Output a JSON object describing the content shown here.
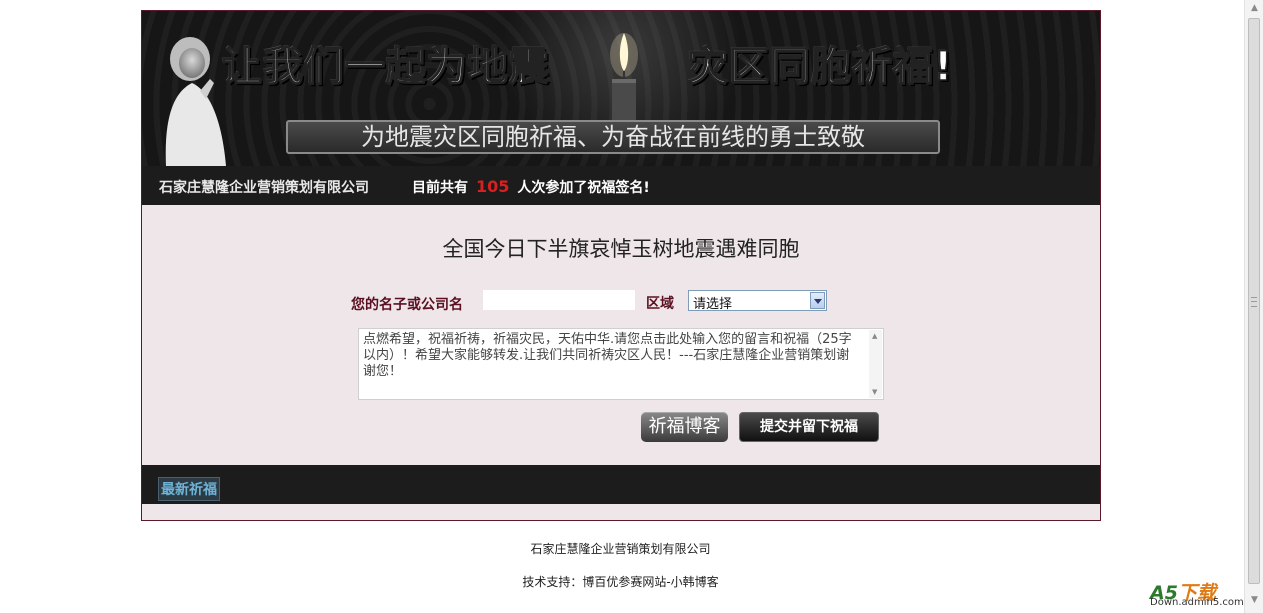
{
  "banner": {
    "headline_left": "让我们一起为地震",
    "headline_right": "灾区同胞祈福!",
    "subtitle": "为地震灾区同胞祈福、为奋战在前线的勇士致敬"
  },
  "info_bar": {
    "company": "石家庄慧隆企业营销策划有限公司",
    "counter_prefix": "目前共有",
    "counter_value": "105",
    "counter_suffix": "人次参加了祝福签名!"
  },
  "form": {
    "title": "全国今日下半旗哀悼玉树地震遇难同胞",
    "name_label": "您的名子或公司名",
    "name_value": "",
    "area_label": "区域",
    "area_selected": "请选择",
    "message_text": "点燃希望，祝福祈祷，祈福灾民，天佑中华.请您点击此处输入您的留言和祝福（25字以内）！希望大家能够转发.让我们共同祈祷灾区人民！---石家庄慧隆企业营销策划谢谢您！",
    "blog_button": "祈福博客",
    "submit_button": "提交并留下祝福"
  },
  "latest": {
    "label": "最新祈福"
  },
  "footer": {
    "line1": "石家庄慧隆企业营销策划有限公司",
    "line2": "技术支持：博百优参赛网站-小韩博客"
  },
  "watermark": {
    "a5": "A5",
    "download": "下载",
    "site": "Down.admin5.com"
  },
  "colors": {
    "frame_border": "#5a1a2a",
    "content_bg": "#efe6ea",
    "bar_bg": "#1c1c1c",
    "count_red": "#d82020",
    "label_maroon": "#5a1020"
  }
}
